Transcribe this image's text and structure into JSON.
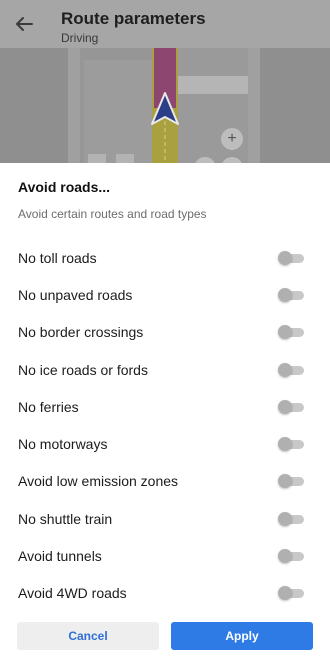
{
  "header": {
    "title": "Route parameters",
    "subtitle": "Driving"
  },
  "sheet": {
    "title": "Avoid roads...",
    "description": "Avoid certain routes and road types",
    "options": [
      {
        "label": "No toll roads",
        "enabled": false
      },
      {
        "label": "No unpaved roads",
        "enabled": false
      },
      {
        "label": "No border crossings",
        "enabled": false
      },
      {
        "label": "No ice roads or fords",
        "enabled": false
      },
      {
        "label": "No ferries",
        "enabled": false
      },
      {
        "label": "No motorways",
        "enabled": false
      },
      {
        "label": "Avoid low emission zones",
        "enabled": false
      },
      {
        "label": "No shuttle train",
        "enabled": false
      },
      {
        "label": "Avoid tunnels",
        "enabled": false
      },
      {
        "label": "Avoid 4WD roads",
        "enabled": false
      }
    ],
    "cancel_label": "Cancel",
    "apply_label": "Apply"
  },
  "map": {
    "zoom_in_symbol": "+"
  },
  "icons": {
    "back": "back-arrow-icon",
    "navigation": "navigation-arrow-icon"
  },
  "colors": {
    "accent": "#2f7be6",
    "route": "#b7478a",
    "road_highlight": "#d7cf4a"
  }
}
